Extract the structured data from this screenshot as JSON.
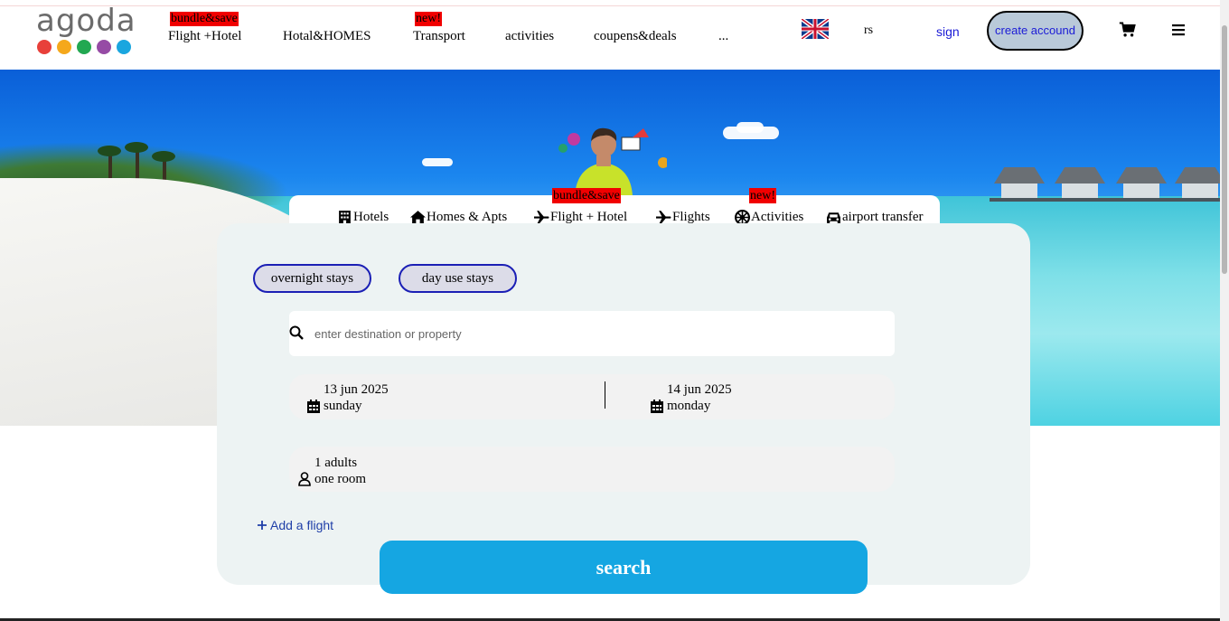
{
  "header": {
    "logo_text": "agoda",
    "logo_dots": [
      "#e8403a",
      "#f5a81c",
      "#22a851",
      "#964ba5",
      "#1aa6df"
    ],
    "nav": [
      {
        "label": "Flight +Hotel",
        "badge": "bundle&save"
      },
      {
        "label": "Hotal&HOMES",
        "badge": ""
      },
      {
        "label": "Transport",
        "badge": "new!"
      },
      {
        "label": "activities",
        "badge": ""
      },
      {
        "label": "coupens&deals",
        "badge": ""
      },
      {
        "label": "...",
        "badge": ""
      }
    ],
    "language": "rs",
    "sign_label": "sign",
    "create_account_label": "create accound"
  },
  "tabs": [
    {
      "label": "Hotels",
      "icon": "hotel-icon",
      "badge": ""
    },
    {
      "label": "Homes & Apts",
      "icon": "home-icon",
      "badge": ""
    },
    {
      "label": "Flight + Hotel",
      "icon": "plane-icon",
      "badge": "bundle&save"
    },
    {
      "label": "Flights",
      "icon": "plane-icon",
      "badge": ""
    },
    {
      "label": "Activities",
      "icon": "activities-icon",
      "badge": "new!"
    },
    {
      "label": "airport transfer",
      "icon": "car-icon",
      "badge": ""
    }
  ],
  "search": {
    "stay_types": [
      "overnight stays",
      "day use stays"
    ],
    "destination_placeholder": "enter destination or property",
    "checkin": {
      "date": "13 jun 2025",
      "day": "sunday"
    },
    "checkout": {
      "date": "14 jun 2025",
      "day": "monday"
    },
    "guests": {
      "adults": "1 adults",
      "rooms": "one room"
    },
    "add_flight_label": "Add a flight",
    "search_label": "search"
  },
  "colors": {
    "badge": "#f10000",
    "search_button": "#15a6e2",
    "pill_border": "#1b1fb5",
    "link": "#1a1ad6"
  }
}
